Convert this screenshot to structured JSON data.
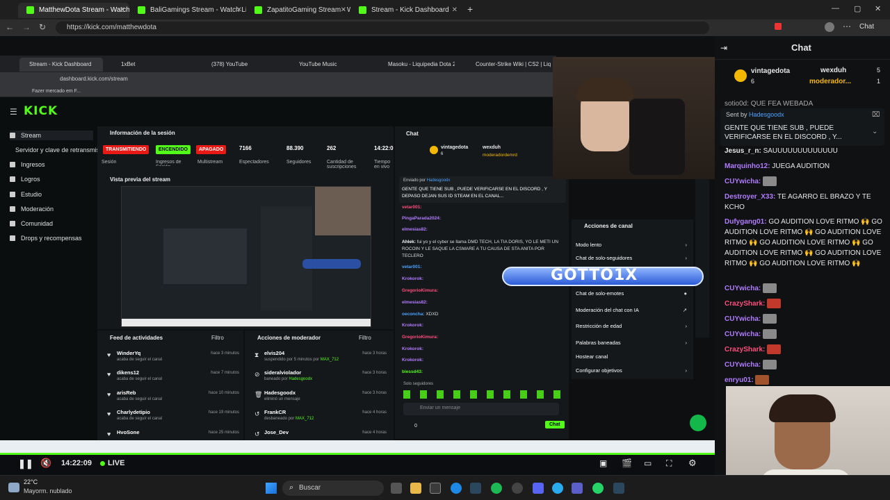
{
  "browser": {
    "tabs": [
      {
        "label": "MatthewDota Stream - Watch Live o",
        "active": true
      },
      {
        "label": "BaliGamings Stream - Watch Live o",
        "active": false
      },
      {
        "label": "ZapatitoGaming Stream - Watch L",
        "active": false
      },
      {
        "label": "Stream - Kick Dashboard",
        "active": false
      }
    ],
    "new_tab": "+",
    "url": "https://kick.com/matthewdota",
    "chat_button": "Chat"
  },
  "inner_browser": {
    "tabs": [
      "Stream - Kick Dashboard",
      "1xBet",
      "(378) YouTube",
      "YouTube Music",
      "Masoku - Liquipedia Dota 2 W",
      "Counter-Strike Wiki | CS2 | Liq"
    ],
    "url": "dashboard.kick.com/stream",
    "bookmark": "Fazer mercado em F..."
  },
  "dashboard": {
    "logo": "KICK",
    "sidebar": {
      "items": [
        "Stream",
        "Servidor y clave de retransmisión",
        "Ingresos",
        "Logros",
        "Estudio",
        "Moderación",
        "Comunidad",
        "Drops y recompensas"
      ]
    },
    "session": {
      "title": "Información de la sesión",
      "badges": [
        "TRANSMITIENDO",
        "ENCENDIDO",
        "APAGADO"
      ],
      "values": [
        "7166",
        "88.390",
        "262",
        "14:22:0"
      ],
      "labels": [
        "Sesión",
        "Ingresos de Sesión",
        "Multistream",
        "Espectadores",
        "Seguidores",
        "Cantidad de suscripciones",
        "Tiempo en vivo"
      ]
    },
    "preview_title": "Vista previa del stream",
    "activity": {
      "title": "Feed de actividades",
      "filter": "Filtro",
      "rows": [
        {
          "name": "WinderYq",
          "sub": "acaba de seguir el canal",
          "time": "hace 3 minutos"
        },
        {
          "name": "dikens12",
          "sub": "acaba de seguir el canal",
          "time": "hace 7 minutos"
        },
        {
          "name": "arisReb",
          "sub": "acaba de seguir el canal",
          "time": "hace 10 minutos"
        },
        {
          "name": "Charlydetipio",
          "sub": "acaba de seguir el canal",
          "time": "hace 19 minutos"
        },
        {
          "name": "HvoSone",
          "sub": "",
          "time": "hace 25 minutos"
        }
      ]
    },
    "mod_actions": {
      "title": "Acciones de moderador",
      "filter": "Filtro",
      "rows": [
        {
          "name": "elvis204",
          "sub": "suspendido por 5 minutos por",
          "by": "MAX_712",
          "time": "hace 3 horas"
        },
        {
          "name": "sideralviolador",
          "sub": "baneado por",
          "by": "Hadesgoodx",
          "time": "hace 3 horas"
        },
        {
          "name": "Hadesgoodx",
          "sub": "eliminó un mensaje",
          "by": "",
          "time": "hace 3 horas"
        },
        {
          "name": "FrankCR",
          "sub": "desbaneado por",
          "by": "MAX_712",
          "time": "hace 4 horas"
        },
        {
          "name": "Jose_Dev",
          "sub": "",
          "by": "",
          "time": "hace 4 horas"
        }
      ]
    },
    "inner_chat": {
      "title": "Chat",
      "pinned_user_left": "vintagedota",
      "pinned_user_left_count": "6",
      "pinned_user_right": "wexduh",
      "pinned_user_right2": "moderadordemrd",
      "pinned_sender": "Enviado por",
      "pinned_sender_name": "Hadesgoodx",
      "pinned_text": "GENTE QUE TIENE SUB , PUEDE VERIFICARSE EN EL DISCORD , Y DEPASO DEJAN SUS ID STEAM EN EL CANAL...",
      "messages": [
        {
          "user": "vetar001:",
          "text": ""
        },
        {
          "user": "PingaParada2024:",
          "text": ""
        },
        {
          "user": "elmesias82:",
          "text": ""
        },
        {
          "user": "Ahlek:",
          "text": "fui yo y el cyber se llama DMD TECH, LA TIA DORIS, YO LE METI UN ROCOIN Y LE SAQUE LA CSMARE A TU CAUSA DE STA ANITA POR TECLERO"
        },
        {
          "user": "vetar001:",
          "text": ""
        },
        {
          "user": "Krokorok:",
          "text": ""
        },
        {
          "user": "GregorioKimura:",
          "text": ""
        },
        {
          "user": "elmesias82:",
          "text": ""
        },
        {
          "user": "oeconcha:",
          "text": "XDXD"
        },
        {
          "user": "Krokorok:",
          "text": ""
        },
        {
          "user": "GregorioKimura:",
          "text": ""
        },
        {
          "user": "Krokorok:",
          "text": ""
        },
        {
          "user": "Krokorok:",
          "text": ""
        },
        {
          "user": "biessd43:",
          "text": ""
        }
      ],
      "followers_only": "Solo seguidores",
      "input_placeholder": "Enviar un mensaje",
      "count": "0",
      "send_button": "Chat"
    },
    "channel_actions": {
      "title": "Acciones de canal",
      "items": [
        "Modo lento",
        "Chat de solo-seguidores",
        "Chat de solo-emotes",
        "Moderación del chat con IA",
        "Restricción de edad",
        "Palabras baneadas",
        "Hostear canal",
        "Configurar objetivos"
      ]
    }
  },
  "overlay": {
    "gotto_text": "GOTTO1X"
  },
  "player": {
    "time": "14:22:09",
    "live": "LIVE"
  },
  "chat": {
    "title": "Chat",
    "top_user1": "vintagedota",
    "top_user1_count": "6",
    "top_user2": "wexduh",
    "top_user2_count": "5",
    "top_user3": "moderador...",
    "top_user3_count": "1",
    "partial_line": "sotio0d: QUE FEA WEBADA",
    "pinned_sender": "Sent by",
    "pinned_sender_name": "Hadesgoodx",
    "pinned_text": "GENTE QUE TIENE SUB , PUEDE VERIFICARSE EN EL DISCORD , Y...",
    "messages": [
      {
        "user": "Jesus_r_n:",
        "text": "SAUUUUUUUUUUUUU",
        "color": "#e6e6e6"
      },
      {
        "user": "Marquinho12:",
        "text": "JUEGA AUDITION",
        "color": "#b27cff"
      },
      {
        "user": "CUYwicha:",
        "text": "",
        "color": "#b27cff"
      },
      {
        "user": "Destroyer_X33:",
        "text": "TE AGARRO EL BRAZO Y TE KCHO",
        "color": "#b27cff"
      },
      {
        "user": "Dufygang01:",
        "text": "GO AUDITION LOVE RITMO 🙌 GO AUDITION LOVE RITMO 🙌 GO AUDITION LOVE RITMO 🙌 GO AUDITION LOVE RITMO 🙌 GO AUDITION LOVE RITMO 🙌 GO AUDITION LOVE RITMO 🙌 GO AUDITION LOVE RITMO 🙌",
        "color": "#b27cff"
      },
      {
        "user": "CUYwicha:",
        "text": "",
        "color": "#b27cff"
      },
      {
        "user": "CrazyShark:",
        "text": "",
        "color": "#ff4f7c"
      },
      {
        "user": "CUYwicha:",
        "text": "",
        "color": "#b27cff"
      },
      {
        "user": "CUYwicha:",
        "text": "",
        "color": "#b27cff"
      },
      {
        "user": "CrazyShark:",
        "text": "",
        "color": "#ff4f7c"
      },
      {
        "user": "CUYwicha:",
        "text": "",
        "color": "#b27cff"
      },
      {
        "user": "enryu01:",
        "text": "",
        "color": "#b27cff"
      }
    ]
  },
  "taskbar": {
    "weather_temp": "22°C",
    "weather_desc": "Mayorm. nublado",
    "search": "Buscar"
  },
  "colors": {
    "kick_green": "#53fc18",
    "live_red": "#e91916"
  }
}
